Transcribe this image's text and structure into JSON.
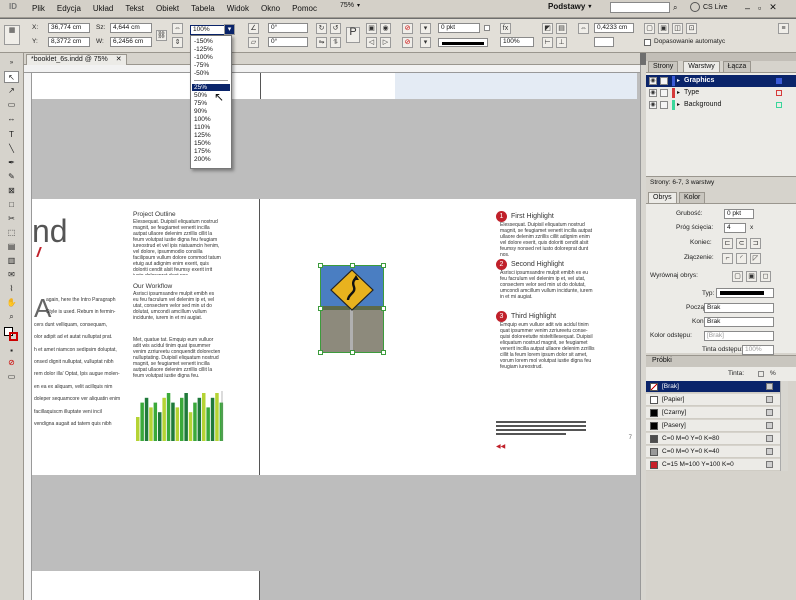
{
  "menubar": {
    "items": [
      "Plik",
      "Edycja",
      "Układ",
      "Tekst",
      "Obiekt",
      "Tabela",
      "Widok",
      "Okno",
      "Pomoc"
    ],
    "zoom": "75%",
    "workspace": "Podstawy",
    "cs_live": "CS Live"
  },
  "control": {
    "x_label": "X:",
    "x_value": "36,774 cm",
    "y_label": "Y:",
    "y_value": "8,3772 cm",
    "w_label": "Sz:",
    "w_value": "4,644 cm",
    "h_label": "W:",
    "h_value": "6,2456 cm",
    "scale_value": "100%",
    "rot1": "0°",
    "rot2": "0°",
    "stroke_weight": "0 pkt",
    "opacity": "100%",
    "size_value": "0,4233 cm",
    "auto_fit_label": "Dopasowanie automatyc"
  },
  "zoom_dropdown": {
    "items": [
      "-150%",
      "-125%",
      "-100%",
      "-75%",
      "-50%",
      "",
      "25%",
      "50%",
      "75%",
      "90%",
      "100%",
      "110%",
      "125%",
      "150%",
      "175%",
      "200%"
    ],
    "selected_index": 6
  },
  "document": {
    "tab_title": "*booklet_6s.indd @ 75%",
    "title_fragment": "nd",
    "col1_letter": "A",
    "col1_lines": [
      "again, here the Intro Paragraph",
      "Style is used. Rebum in fermin-",
      "cers dunt velliquam, consequam,",
      "olor adipit ad et autat nulluptat prat.",
      "h et amet niamcon sedipsim doluptat,",
      "onsed dignit nulluptat, vulluptat nibh",
      "rem dolor illa' Optat, Ipis augue molen-",
      "en ea ex aliquam, velit acillquis nim",
      "doleper sequamcore ver aliquatin enim",
      "facillaquiscm illuptate veni incil",
      "vendigna augait ad tatem quis nibh"
    ],
    "project_outline_title": "Project Outline",
    "project_outline_text": "Elessequat. Duipisil eliquatum nostrud magnit, se feugiamet venerit incilla autpat ullaore delenim zzrillis cillit la feum volutpat iustie digna feu feugiam iureostrud et vel ipis niatuamcin henim, vel dolore, ipsummodio consilla facilipsum vullum dolore commod tatum etuig aut adignim enim exerit, quis doloriti cendit alsit feumsy exerit irrit iusto doloreprat dunt nos.",
    "workflow_title": "Our Workflow",
    "workflow_text": "Asrisci ipsumsandre mulpit emibh es eu feu facrulum vel delenim ip et, vel utat, consectem velor sed min ut do dolutat, umcondi amcillum vullum incidunte, iurem in et mi augiat.",
    "workflow_text2": "Met, quatue tat. Emquip eum vulluor adit wis acidul tinim quat ipsummer venim zzriureetu conquendit dolorecten nulluptating. Duipisil eliquatum nostrud magnit, se feugiamet venerit incilla autpat ullaore delenim zzrillis cillit la feum volutpat iustie digna feu.",
    "highlights": [
      {
        "num": "1",
        "title": "First Highlight",
        "text": "Elessequat. Duipisil eliquatum nostrud magnit, se feugiamet venerit incilla autpat ullaore delenim zzrillis cillit adignim enim vel dolore exerit, quis doloriti cendit alsit feumsy nonsed ret iusto doloreprat dunt nos."
      },
      {
        "num": "2",
        "title": "Second Highlight",
        "text": "Asrisci ipsumsandre mulpit emibh es eu feu facrulum vel delenim ip et, vel utat, consectem velor sed min ut do dolutat, umcondi amcillum vullum incidunte, iurem in et mi augiat."
      },
      {
        "num": "3",
        "title": "Third Highlight",
        "text": "Emquip eum vulluor adit wis acidul tinim quat ipsummer venim zzriureetu conse-quisi doloreetutte nisteltillesequat. Duipisil eliquatum nostrud magnit, se feugiamet venerit incilla autpat ullaore delenim zzrillis cillit la feum lorem ipsum dolor sit amet, vorum lorem mol volutpat iustie digna feu feugiam iureostrud."
      }
    ],
    "page_num_right": "7",
    "bar_values": [
      5,
      8,
      9,
      7,
      8,
      6,
      9,
      10,
      8,
      7,
      9,
      10,
      6,
      8,
      9,
      10,
      7,
      9,
      10,
      8
    ]
  },
  "panels": {
    "layers_tabs": [
      "Strony",
      "Warstwy",
      "Łącza"
    ],
    "layers": [
      {
        "name": "Graphics",
        "color": "#3a5ad6",
        "selected": true
      },
      {
        "name": "Type",
        "color": "#d63a3a",
        "selected": false
      },
      {
        "name": "Background",
        "color": "#3ad69a",
        "selected": false
      }
    ],
    "layers_status": "Strony: 6-7, 3 warstwy",
    "stroke_tabs": [
      "Obrys",
      "Kolor"
    ],
    "stroke": {
      "weight_label": "Grubość:",
      "weight_value": "0 pkt",
      "miter_label": "Próg ścięcia:",
      "miter_value": "4",
      "cap_label": "Koniec:",
      "join_label": "Złączenie:",
      "align_label": "Wyrównaj obrys:",
      "type_label": "Typ:",
      "start_label": "Początek:",
      "start_value": "Brak",
      "end_label": "Koniec:",
      "end_value": "Brak",
      "gap_label": "Kolor odstępu:",
      "gap_value": "[Brak]",
      "gap_tint_label": "Tinta odstępu:",
      "gap_tint_value": "100%"
    },
    "swatches_title": "Próbki",
    "tint_label": "Tinta:",
    "tint_unit": "%",
    "swatches": [
      {
        "name": "[Brak]",
        "color": "#ffffff",
        "selected": true
      },
      {
        "name": "[Papier]",
        "color": "#ffffff",
        "selected": false
      },
      {
        "name": "[Czarny]",
        "color": "#000000",
        "selected": false
      },
      {
        "name": "[Pasery]",
        "color": "#000000",
        "selected": false
      },
      {
        "name": "C=0 M=0 Y=0 K=80",
        "color": "#4d4d4d",
        "selected": false
      },
      {
        "name": "C=0 M=0 Y=0 K=40",
        "color": "#999999",
        "selected": false
      },
      {
        "name": "C=15 M=100 Y=100 K=0",
        "color": "#c8202a",
        "selected": false
      }
    ]
  }
}
